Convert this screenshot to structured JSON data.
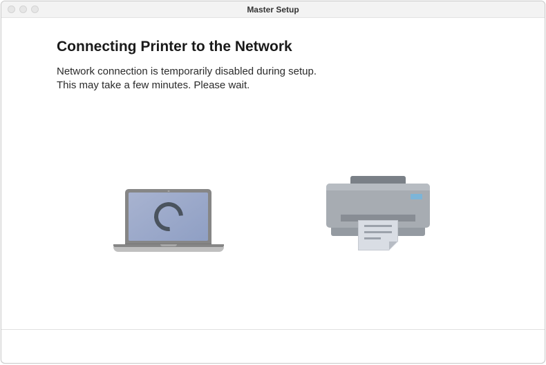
{
  "window": {
    "title": "Master Setup"
  },
  "heading": "Connecting Printer to the Network",
  "body_line1": "Network connection is temporarily disabled during setup.",
  "body_line2": "This may take a few minutes. Please wait."
}
